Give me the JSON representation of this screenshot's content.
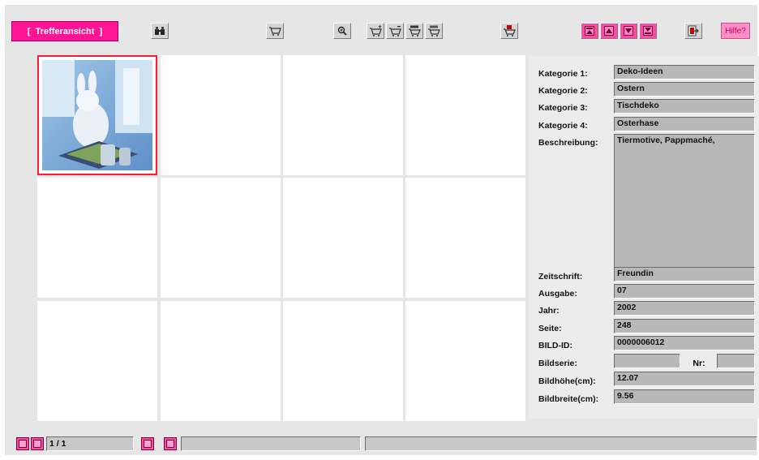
{
  "toolbar": {
    "results_view_label": "[  Trefferansicht  ]",
    "help_label": "Hilfe?",
    "icons": [
      "binoculars-icon",
      "cart-icon",
      "magnify-icon",
      "cart-add-icon",
      "cart-remove-icon",
      "cart-add-all-icon",
      "cart-remove-all-icon",
      "cart-checkout-icon",
      "first-page-icon",
      "previous-icon",
      "next-icon",
      "last-page-icon",
      "exit-icon"
    ]
  },
  "details": {
    "kategorie1_label": "Kategorie 1:",
    "kategorie1_value": "Deko-Ideen",
    "kategorie2_label": "Kategorie 2:",
    "kategorie2_value": "Ostern",
    "kategorie3_label": "Kategorie 3:",
    "kategorie3_value": "Tischdeko",
    "kategorie4_label": "Kategorie 4:",
    "kategorie4_value": "Osterhase",
    "beschreibung_label": "Beschreibung:",
    "beschreibung_value": "Tiermotive, Pappmaché,",
    "zeitschrift_label": "Zeitschrift:",
    "zeitschrift_value": "Freundin",
    "ausgabe_label": "Ausgabe:",
    "ausgabe_value": "07",
    "jahr_label": "Jahr:",
    "jahr_value": "2002",
    "seite_label": "Seite:",
    "seite_value": "248",
    "bildid_label": "BILD-ID:",
    "bildid_value": "0000006012",
    "bildserie_label": "Bildserie:",
    "bildserie_value": "",
    "nr_label": "Nr:",
    "nr_value": "",
    "hoehe_label": "Bildhöhe(cm):",
    "hoehe_value": "12.07",
    "breite_label": "Bildbreite(cm):",
    "breite_value": "9.56"
  },
  "status": {
    "page_indicator": "1 / 1",
    "message": "",
    "info": ""
  },
  "colors": {
    "accent": "#ff1493",
    "selection": "#ff1a3a",
    "field": "#b8b8b8"
  }
}
